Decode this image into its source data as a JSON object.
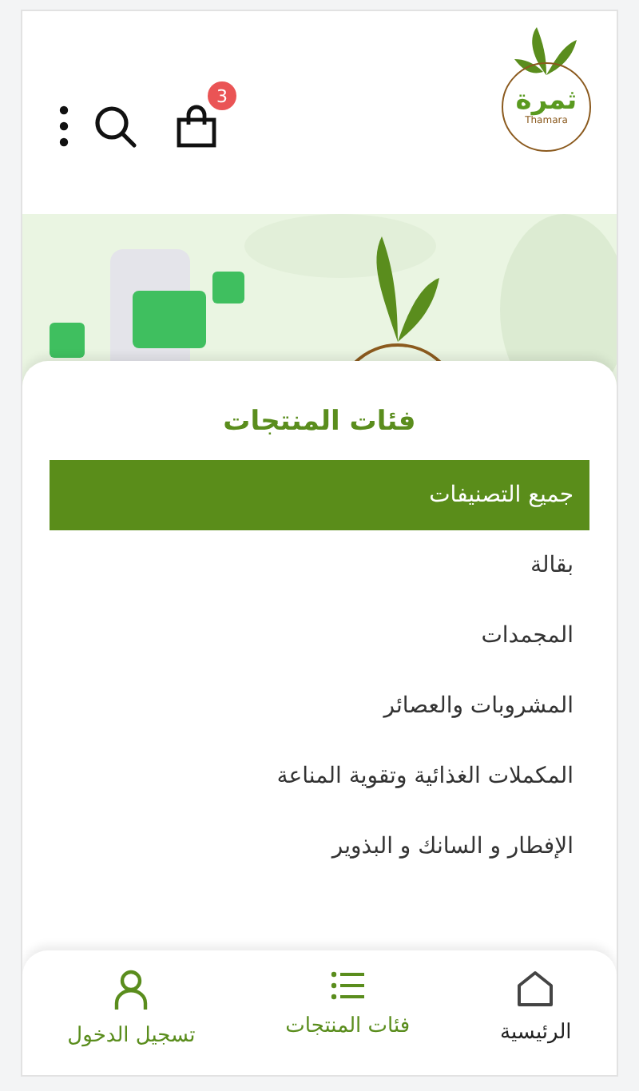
{
  "header": {
    "logo": {
      "name": "ثمرة",
      "subtitle": "Thamara"
    },
    "cart_badge": "3"
  },
  "categories": {
    "title": "فئات المنتجات",
    "items": [
      {
        "label": "جميع التصنيفات",
        "selected": true
      },
      {
        "label": "بقالة",
        "selected": false
      },
      {
        "label": "المجمدات",
        "selected": false
      },
      {
        "label": "المشروبات والعصائر",
        "selected": false
      },
      {
        "label": "المكملات الغذائية وتقوية المناعة",
        "selected": false
      },
      {
        "label": "الإفطار و السانك و البذوير",
        "selected": false
      }
    ]
  },
  "bottom_nav": [
    {
      "kind": "home",
      "label": "الرئيسية"
    },
    {
      "kind": "categories",
      "label": "فئات المنتجات"
    },
    {
      "kind": "account",
      "label": "تسجيل الدخول"
    }
  ]
}
